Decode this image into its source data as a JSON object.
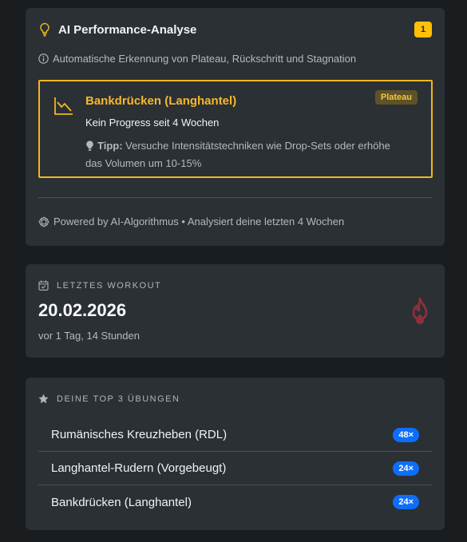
{
  "ai_card": {
    "icon": "lightbulb-icon",
    "title": "AI Performance-Analyse",
    "badge_count": "1",
    "subtitle": "Automatische Erkennung von Plateau, Rückschritt und Stagnation",
    "alert": {
      "icon": "trend-down-icon",
      "exercise": "Bankdrücken (Langhantel)",
      "status": "Plateau",
      "message": "Kein Progress seit 4 Wochen",
      "tip_label": "Tipp:",
      "tip_text": "Versuche Intensitätstechniken wie Drop-Sets oder erhöhe das Volumen um 10-15%",
      "accent_color": "#f1b71c"
    },
    "footer": "Powered by AI-Algorithmus • Analysiert deine letzten 4 Wochen"
  },
  "workout_card": {
    "heading": "LETZTES WORKOUT",
    "date": "20.02.2026",
    "ago": "vor 1 Tag, 14 Stunden",
    "icon": "flame-icon"
  },
  "top_card": {
    "heading": "DEINE TOP 3 ÜBUNGEN",
    "items": [
      {
        "name": "Rumänisches Kreuzheben (RDL)",
        "count": "48×"
      },
      {
        "name": "Langhantel-Rudern (Vorgebeugt)",
        "count": "24×"
      },
      {
        "name": "Bankdrücken (Langhantel)",
        "count": "24×"
      }
    ]
  }
}
